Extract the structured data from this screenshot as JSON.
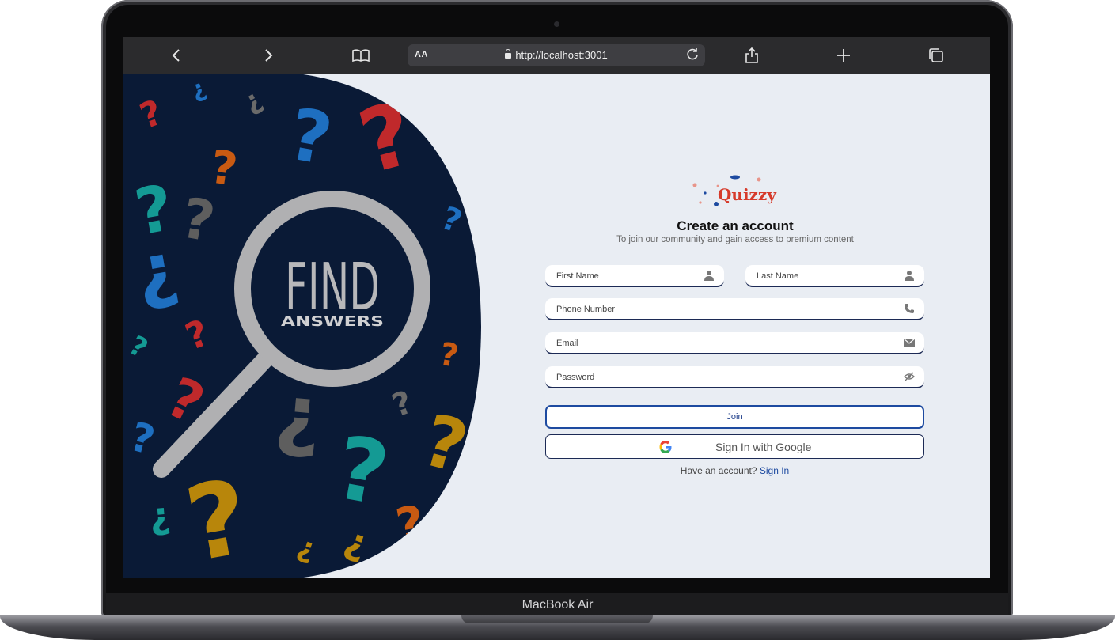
{
  "device": {
    "model_label": "MacBook Air"
  },
  "browser": {
    "text_size_label": "AA",
    "url": "http://localhost:3001",
    "icons": [
      "back-icon",
      "forward-icon",
      "bookmarks-icon",
      "reload-icon",
      "share-icon",
      "new-tab-icon",
      "tabs-icon"
    ]
  },
  "hero": {
    "line1": "FIND",
    "line2": "ANSWERS"
  },
  "logo": {
    "text": "Quizzy"
  },
  "form": {
    "title": "Create an account",
    "subtitle": "To join our community and gain access to premium content",
    "first_name_placeholder": "First Name",
    "last_name_placeholder": "Last Name",
    "phone_placeholder": "Phone Number",
    "email_placeholder": "Email",
    "password_placeholder": "Password",
    "join_label": "Join",
    "google_label": "Sign In with Google",
    "have_account_text": "Have an account?",
    "sign_in_link": "Sign In"
  },
  "colors": {
    "navy": "#0a1a36",
    "accent_blue": "#1d4aa0",
    "logo_red": "#d63a2a",
    "form_bg": "#e9edf3"
  }
}
